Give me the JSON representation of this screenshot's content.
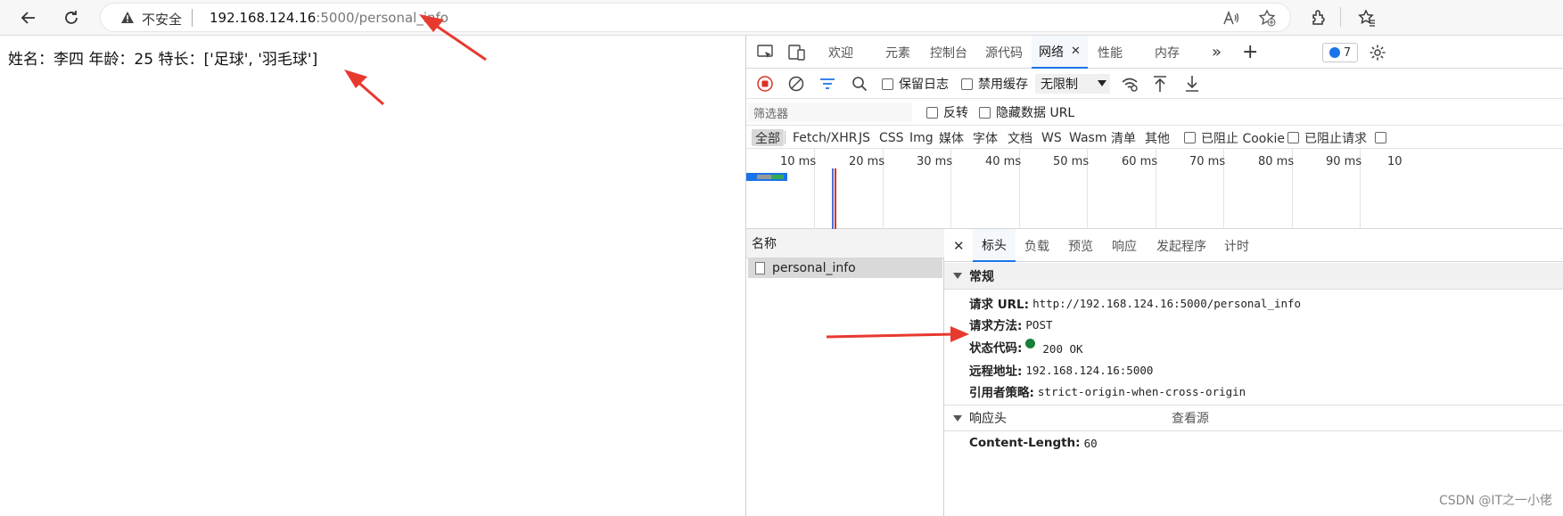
{
  "browser": {
    "security_label": "不安全",
    "url_host": "192.168.124.16",
    "url_rest": ":5000/personal_info"
  },
  "page": {
    "content": "姓名：李四 年龄：25 特长：['足球', '羽毛球']"
  },
  "devtools": {
    "tabs": [
      "欢迎",
      "元素",
      "控制台",
      "源代码",
      "网络",
      "性能",
      "内存"
    ],
    "active_tab": "网络",
    "issues_count": "7",
    "toolbar": {
      "preserve_log": "保留日志",
      "disable_cache": "禁用缓存",
      "throttle": "无限制"
    },
    "filter": {
      "placeholder": "筛选器",
      "invert": "反转",
      "hide_data_urls": "隐藏数据 URL"
    },
    "types": [
      "全部",
      "Fetch/XHR",
      "JS",
      "CSS",
      "Img",
      "媒体",
      "字体",
      "文档",
      "WS",
      "Wasm",
      "清单",
      "其他"
    ],
    "blocked_cookies": "已阻止 Cookie",
    "blocked_requests": "已阻止请求",
    "timeline_ticks": [
      "10 ms",
      "20 ms",
      "30 ms",
      "40 ms",
      "50 ms",
      "60 ms",
      "70 ms",
      "80 ms",
      "90 ms",
      "10"
    ],
    "name_header": "名称",
    "request_name": "personal_info",
    "detail_tabs": [
      "标头",
      "负载",
      "预览",
      "响应",
      "发起程序",
      "计时"
    ],
    "general": {
      "title": "常规",
      "rows": [
        {
          "k": "请求 URL:",
          "v": "http://192.168.124.16:5000/personal_info"
        },
        {
          "k": "请求方法:",
          "v": "POST"
        },
        {
          "k": "状态代码:",
          "v": "200 OK"
        },
        {
          "k": "远程地址:",
          "v": "192.168.124.16:5000"
        },
        {
          "k": "引用者策略:",
          "v": "strict-origin-when-cross-origin"
        }
      ]
    },
    "response_headers": {
      "title": "响应头",
      "view_source": "查看源",
      "rows": [
        {
          "k": "Content-Length:",
          "v": "60"
        }
      ]
    }
  },
  "watermark": "CSDN @IT之一小佬",
  "colors": {
    "accent": "#1a73e8",
    "annotation_arrow": "#e8392f",
    "status_ok": "#188038"
  }
}
